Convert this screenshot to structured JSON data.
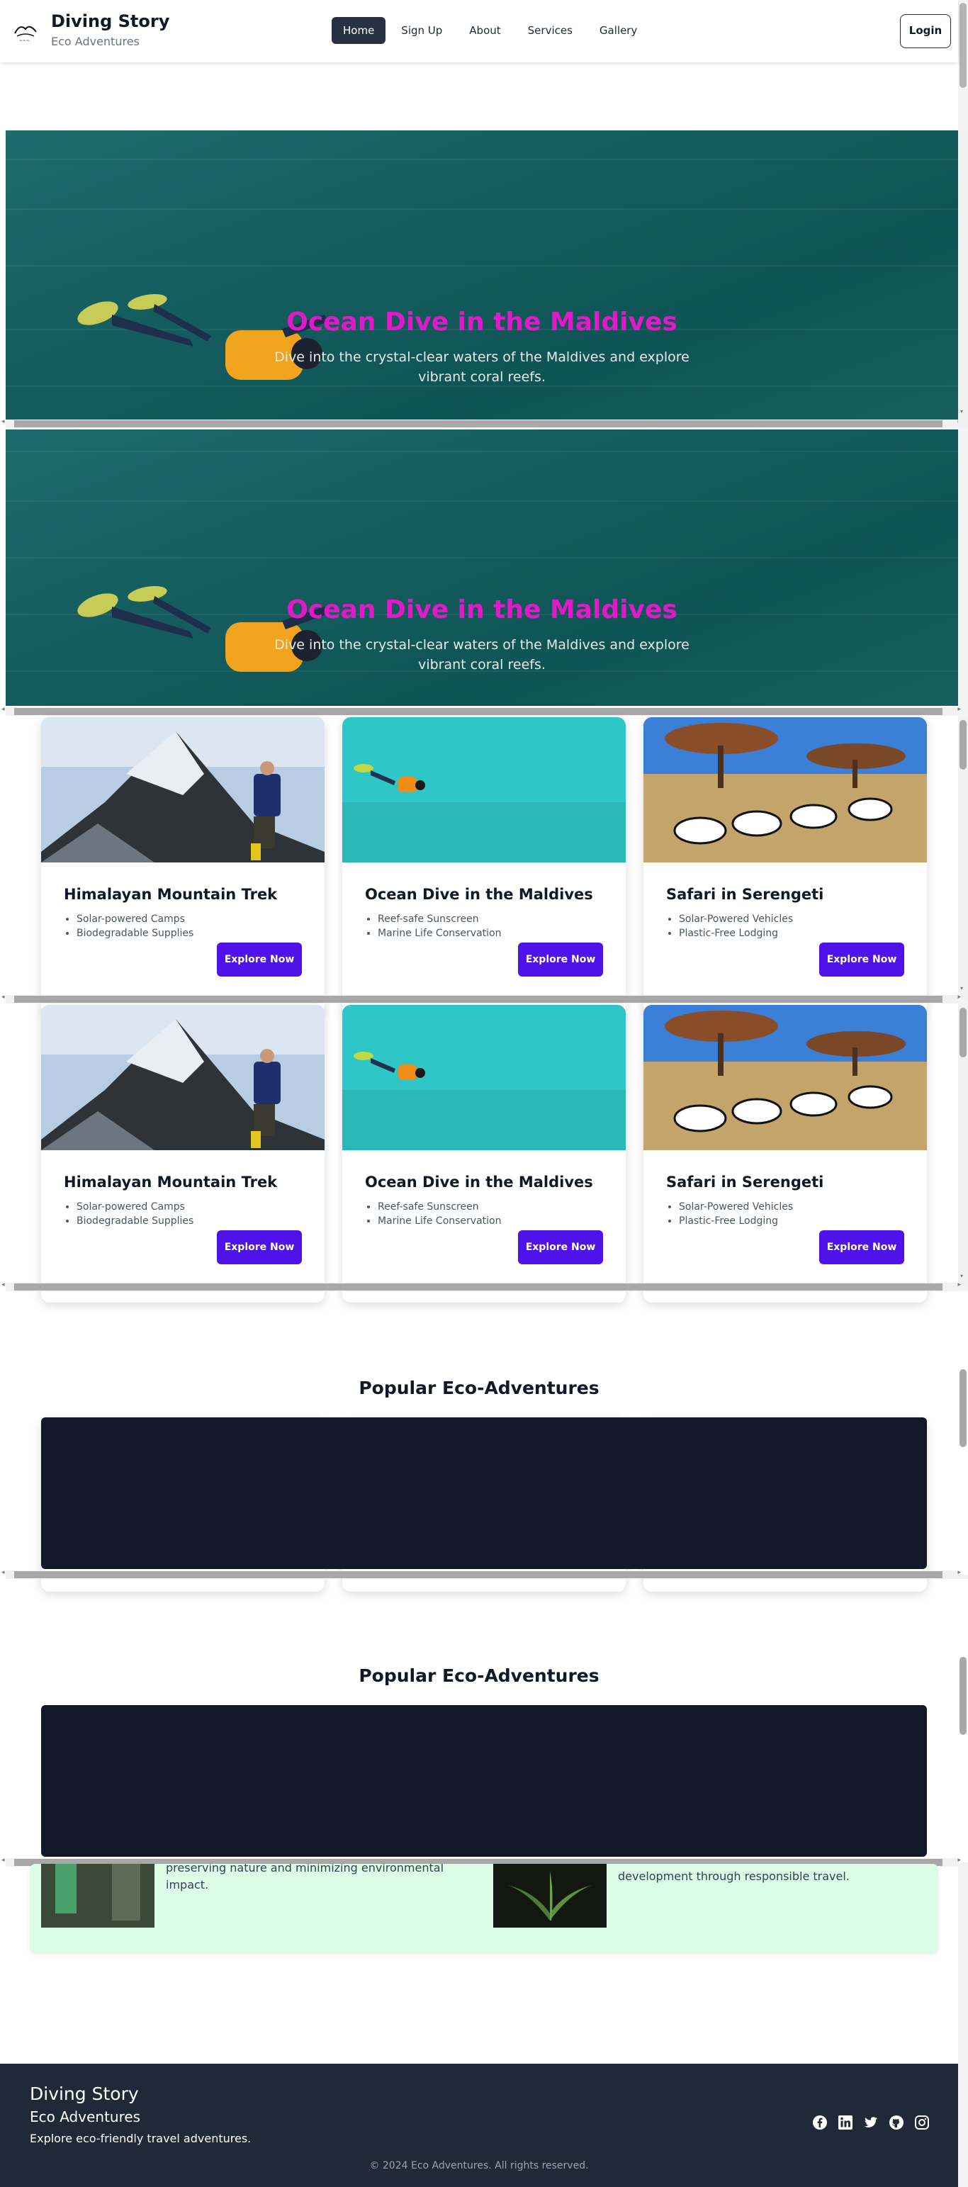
{
  "header": {
    "brand_title": "Diving Story",
    "brand_subtitle": "Eco Adventures",
    "nav": [
      {
        "label": "Home",
        "active": true
      },
      {
        "label": "Sign Up"
      },
      {
        "label": "About"
      },
      {
        "label": "Services"
      },
      {
        "label": "Gallery"
      }
    ],
    "login_label": "Login"
  },
  "hero": {
    "title": "Ocean Dive in the Maldives",
    "description": "Dive into the crystal-clear waters of the Maldives and explore vibrant coral reefs.",
    "title_color": "#e11ac7"
  },
  "cards": [
    {
      "title": "Himalayan Mountain Trek",
      "features": [
        "Solar-powered Camps",
        "Biodegradable Supplies"
      ],
      "button": "Explore Now"
    },
    {
      "title": "Ocean Dive in the Maldives",
      "features": [
        "Reef-safe Sunscreen",
        "Marine Life Conservation"
      ],
      "button": "Explore Now"
    },
    {
      "title": "Safari in Serengeti",
      "features": [
        "Solar-Powered Vehicles",
        "Plastic-Free Lodging"
      ],
      "button": "Explore Now"
    }
  ],
  "popular": {
    "title": "Popular Eco-Adventures"
  },
  "green": {
    "left_text_line1": "preserving nature and minimizing environmental",
    "left_text_line2": "impact.",
    "right_text": "development through responsible travel."
  },
  "footer": {
    "title": "Diving Story",
    "subtitle": "Eco Adventures",
    "tagline": "Explore eco-friendly travel adventures.",
    "social_icons": [
      "facebook-icon",
      "linkedin-icon",
      "twitter-icon",
      "github-icon",
      "instagram-icon"
    ],
    "copyright": "© 2024 Eco Adventures. All rights reserved."
  },
  "colors": {
    "primary_button": "#4f12e8",
    "footer_bg": "#1f2937",
    "dark_box": "#121828",
    "green_bg": "#dcfce7"
  }
}
